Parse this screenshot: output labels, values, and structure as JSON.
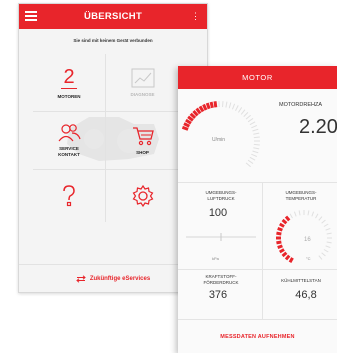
{
  "menu_screen": {
    "title": "ÜBERSICHT",
    "notice": "Sie sind mit keinem Gerät verbunden",
    "tiles": [
      {
        "label": "MOTOREN",
        "count": "2",
        "icon": "number",
        "dimmed": false
      },
      {
        "label": "DIAGNOSE",
        "icon": "chart-icon",
        "dimmed": true
      },
      {
        "label": "SERVICE\nKONTAKT",
        "icon": "people-icon",
        "dimmed": false
      },
      {
        "label": "SHOP",
        "icon": "cart-icon",
        "dimmed": false
      },
      {
        "label": "",
        "icon": "help-icon",
        "dimmed": false
      },
      {
        "label": "",
        "icon": "settings-icon",
        "dimmed": false
      }
    ],
    "footer": "Zukünftige eServices"
  },
  "motor_screen": {
    "title": "MOTOR",
    "rpm_label": "MOTORDREHZA",
    "rpm_value": "2.20",
    "rpm_unit": "U/min",
    "air_pressure_label": "UMGEBUNGS-\nLUFTDRUCK",
    "air_pressure_value": "100",
    "air_pressure_unit": "kPa",
    "ambient_temp_label": "UMGEBUNGS-\nTEMPERATUR",
    "ambient_temp_gauge_value": "16",
    "ambient_temp_unit": "°C",
    "fuel_pressure_label": "KRAFTSTOFF-\nFÖRDERDRUCK",
    "fuel_pressure_value": "376",
    "coolant_label": "KÜHLMITTELSTAN",
    "coolant_value": "46,8",
    "footer": "MESSDATEN AUFNEHMEN"
  },
  "colors": {
    "accent": "#e8252b",
    "text": "#333333",
    "dim": "#b8b8b8"
  }
}
